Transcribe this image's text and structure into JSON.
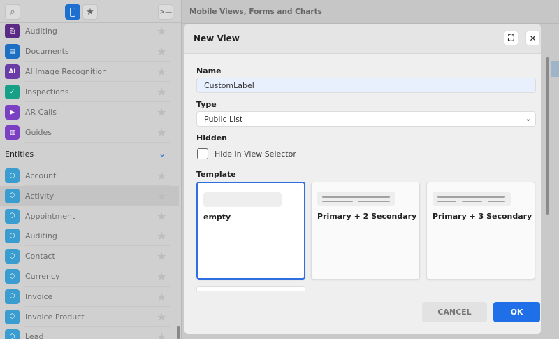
{
  "sidebar": {
    "apps": [
      {
        "label": "Auditing",
        "color": "#5b2a86",
        "icon": "clipboard-search-icon"
      },
      {
        "label": "Documents",
        "color": "#1d6fc4",
        "icon": "document-icon"
      },
      {
        "label": "AI Image Recognition",
        "color": "#6a3ca8",
        "icon": "ai-chip-icon"
      },
      {
        "label": "Inspections",
        "color": "#16a085",
        "icon": "check-circle-icon"
      },
      {
        "label": "AR Calls",
        "color": "#7b3fc4",
        "icon": "video-icon"
      },
      {
        "label": "Guides",
        "color": "#7b3fc4",
        "icon": "book-icon"
      }
    ],
    "section": "Entities",
    "entities": [
      {
        "label": "Account"
      },
      {
        "label": "Activity"
      },
      {
        "label": "Appointment"
      },
      {
        "label": "Auditing"
      },
      {
        "label": "Contact"
      },
      {
        "label": "Currency"
      },
      {
        "label": "Invoice"
      },
      {
        "label": "Invoice Product"
      },
      {
        "label": "Lead"
      }
    ],
    "entity_color": "#3b9ccf",
    "selected_entity": "Activity"
  },
  "main": {
    "title": "Mobile Views, Forms and Charts"
  },
  "dialog": {
    "title": "New View",
    "name_label": "Name",
    "name_value": "CustomLabel",
    "type_label": "Type",
    "type_value": "Public List",
    "hidden_label": "Hidden",
    "hidden_checkbox": "Hide in View Selector",
    "hidden_checked": false,
    "template_label": "Template",
    "templates": [
      {
        "label": "empty"
      },
      {
        "label": "Primary + 2 Secondary"
      },
      {
        "label": "Primary + 3 Secondary"
      }
    ],
    "selected_template": "empty",
    "cancel": "CANCEL",
    "ok": "OK",
    "accent": "#1f6fe8"
  }
}
